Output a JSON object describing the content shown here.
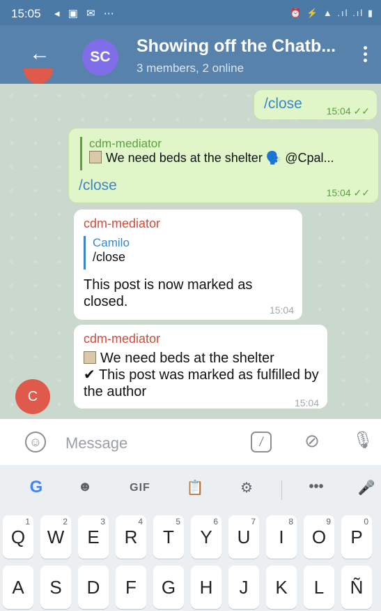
{
  "status_bar": {
    "time": "15:05"
  },
  "header": {
    "avatar_initials": "SC",
    "title": "Showing off the Chatb...",
    "subtitle": "3 members, 2 online"
  },
  "messages": [
    {
      "type": "outgoing",
      "text": "/close",
      "time": "15:04"
    },
    {
      "type": "outgoing",
      "reply_to": {
        "sender": "cdm-mediator",
        "text": "We need beds at the shelter 🗣️ @Cpal..."
      },
      "text": "/close",
      "time": "15:04"
    },
    {
      "type": "incoming",
      "sender": "cdm-mediator",
      "reply_to": {
        "sender": "Camilo",
        "text": "/close"
      },
      "text": "This post is now marked as closed.",
      "time": "15:04"
    },
    {
      "type": "incoming",
      "sender": "cdm-mediator",
      "line1": "We need beds at the shelter",
      "line2": "✔ This post was marked as fulfilled by the author",
      "time": "15:04",
      "avatar_initial": "C"
    }
  ],
  "input": {
    "placeholder": "Message"
  },
  "keyboard": {
    "toolbar": {
      "gif_label": "GIF"
    },
    "row1": [
      {
        "key": "Q",
        "hint": "1"
      },
      {
        "key": "W",
        "hint": "2"
      },
      {
        "key": "E",
        "hint": "3"
      },
      {
        "key": "R",
        "hint": "4"
      },
      {
        "key": "T",
        "hint": "5"
      },
      {
        "key": "Y",
        "hint": "6"
      },
      {
        "key": "U",
        "hint": "7"
      },
      {
        "key": "I",
        "hint": "8"
      },
      {
        "key": "O",
        "hint": "9"
      },
      {
        "key": "P",
        "hint": "0"
      }
    ],
    "row2": [
      "A",
      "S",
      "D",
      "F",
      "G",
      "H",
      "J",
      "K",
      "L",
      "Ñ"
    ]
  },
  "colors": {
    "header": "#5682ab",
    "status_bar": "#4c7aa6",
    "outgoing_bubble": "#e0f6c8",
    "sender_name": "#d14b3b",
    "link": "#3a86c6",
    "avatar_sc": "#7f6ee8",
    "avatar_c": "#df5a4a"
  },
  "icons": [
    "arrow-left-icon",
    "more-vert-icon",
    "emoji-icon",
    "slash-command-icon",
    "paperclip-icon",
    "mic-icon",
    "google-icon",
    "sticker-icon",
    "clipboard-icon",
    "gear-icon",
    "ellipsis-icon"
  ]
}
